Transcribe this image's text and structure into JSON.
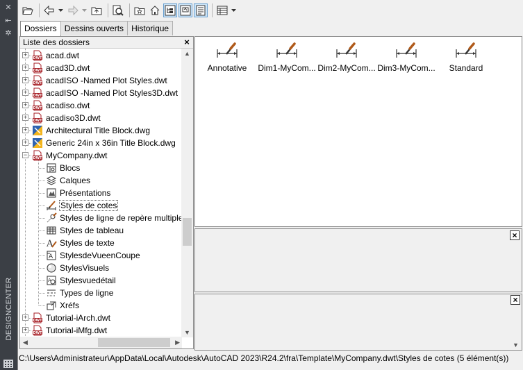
{
  "window": {
    "vertical_title": "DESIGNCENTER"
  },
  "tabs": [
    {
      "label": "Dossiers",
      "active": true
    },
    {
      "label": "Dessins ouverts",
      "active": false
    },
    {
      "label": "Historique",
      "active": false
    }
  ],
  "left_pane": {
    "header": "Liste des dossiers",
    "close_glyph": "×",
    "items": [
      {
        "label": "acad.dwt",
        "icon": "dwt-file-icon",
        "level": 0,
        "expander": "+"
      },
      {
        "label": "acad3D.dwt",
        "icon": "dwt-file-icon",
        "level": 0,
        "expander": "+"
      },
      {
        "label": "acadISO -Named Plot Styles.dwt",
        "icon": "dwt-file-icon",
        "level": 0,
        "expander": "+"
      },
      {
        "label": "acadISO -Named Plot Styles3D.dwt",
        "icon": "dwt-file-icon",
        "level": 0,
        "expander": "+"
      },
      {
        "label": "acadiso.dwt",
        "icon": "dwt-file-icon",
        "level": 0,
        "expander": "+"
      },
      {
        "label": "acadiso3D.dwt",
        "icon": "dwt-file-icon",
        "level": 0,
        "expander": "+"
      },
      {
        "label": "Architectural Title Block.dwg",
        "icon": "dwg-file-icon",
        "level": 0,
        "expander": "+"
      },
      {
        "label": "Generic 24in x 36in Title Block.dwg",
        "icon": "dwg-file-icon",
        "level": 0,
        "expander": "+"
      },
      {
        "label": "MyCompany.dwt",
        "icon": "dwt-file-icon",
        "level": 0,
        "expander": "−"
      },
      {
        "label": "Blocs",
        "icon": "blocks-icon",
        "level": 1
      },
      {
        "label": "Calques",
        "icon": "layers-icon",
        "level": 1
      },
      {
        "label": "Présentations",
        "icon": "layouts-icon",
        "level": 1
      },
      {
        "label": "Styles de cotes",
        "icon": "dimstyle-icon",
        "level": 1,
        "selected": true
      },
      {
        "label": "Styles de ligne de repère multiple",
        "icon": "mleader-icon",
        "level": 1
      },
      {
        "label": "Styles de tableau",
        "icon": "table-style-icon",
        "level": 1
      },
      {
        "label": "Styles de texte",
        "icon": "text-style-icon",
        "level": 1
      },
      {
        "label": "StylesdeVueenCoupe",
        "icon": "section-view-icon",
        "level": 1
      },
      {
        "label": "StylesVisuels",
        "icon": "visual-style-icon",
        "level": 1
      },
      {
        "label": "Stylesvuedétail",
        "icon": "detail-view-icon",
        "level": 1
      },
      {
        "label": "Types de ligne",
        "icon": "linetype-icon",
        "level": 1
      },
      {
        "label": "Xréfs",
        "icon": "xref-icon",
        "level": 1
      },
      {
        "label": "Tutorial-iArch.dwt",
        "icon": "dwt-file-icon",
        "level": 0,
        "expander": "+"
      },
      {
        "label": "Tutorial-iMfg.dwt",
        "icon": "dwt-file-icon",
        "level": 0,
        "expander": "+"
      }
    ]
  },
  "content": {
    "items": [
      {
        "label": "Annotative"
      },
      {
        "label": "Dim1-MyCom..."
      },
      {
        "label": "Dim2-MyCom..."
      },
      {
        "label": "Dim3-MyCom..."
      },
      {
        "label": "Standard"
      }
    ]
  },
  "preview_close": "×",
  "description_close": "×",
  "status": "C:\\Users\\Administrateur\\AppData\\Local\\Autodesk\\AutoCAD 2023\\R24.2\\fra\\Template\\MyCompany.dwt\\Styles de cotes (5 élément(s))",
  "colors": {
    "dwt_red": "#a61d24",
    "panel_bg": "#f0f0f0",
    "titlebar_bg": "#3b3f45",
    "pressed_bg": "#cce4f7"
  }
}
